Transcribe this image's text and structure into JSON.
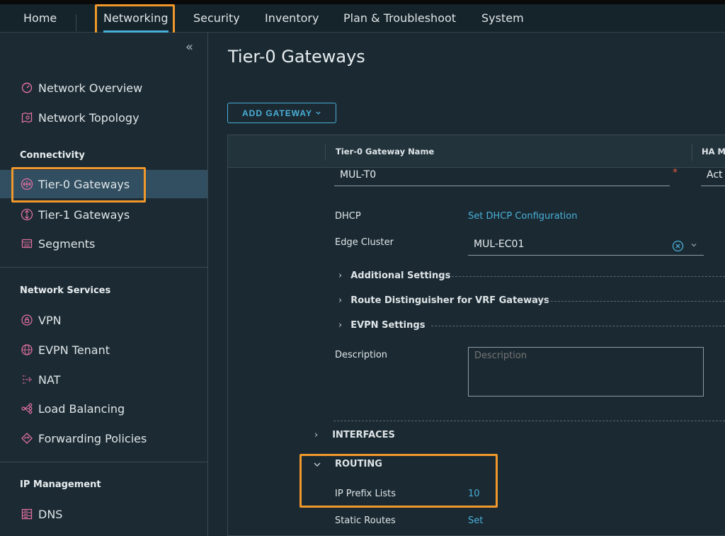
{
  "topnav": {
    "home": "Home",
    "networking": "Networking",
    "security": "Security",
    "inventory": "Inventory",
    "plan": "Plan & Troubleshoot",
    "system": "System"
  },
  "sidebar": {
    "collapse_icon": "«",
    "network_overview": "Network Overview",
    "network_topology": "Network Topology",
    "connectivity_heading": "Connectivity",
    "tier0": "Tier-0 Gateways",
    "tier1": "Tier-1 Gateways",
    "segments": "Segments",
    "network_services_heading": "Network Services",
    "vpn": "VPN",
    "evpn": "EVPN Tenant",
    "nat": "NAT",
    "load_balancing": "Load Balancing",
    "forwarding": "Forwarding Policies",
    "ip_management_heading": "IP Management",
    "dns": "DNS"
  },
  "main": {
    "title": "Tier-0 Gateways",
    "add_button": "ADD GATEWAY",
    "col_name": "Tier-0 Gateway Name",
    "col_ha": "HA M",
    "gateway_name": "MUL-T0",
    "ha_value": "Act",
    "dhcp_label": "DHCP",
    "dhcp_link": "Set DHCP Configuration",
    "edge_cluster_label": "Edge Cluster",
    "edge_cluster_value": "MUL-EC01",
    "additional_settings": "Additional Settings",
    "route_distinguisher": "Route Distinguisher for VRF Gateways",
    "evpn_settings": "EVPN Settings",
    "description_label": "Description",
    "description_placeholder": "Description",
    "interfaces": "INTERFACES",
    "routing": "ROUTING",
    "ip_prefix_lists_label": "IP Prefix Lists",
    "ip_prefix_lists_value": "10",
    "static_routes_label": "Static Routes",
    "static_routes_value": "Set"
  },
  "colors": {
    "accent": "#49afd9",
    "highlight": "#f0982b",
    "active_bg": "#324f61",
    "icon_pink": "#e06fa0"
  }
}
